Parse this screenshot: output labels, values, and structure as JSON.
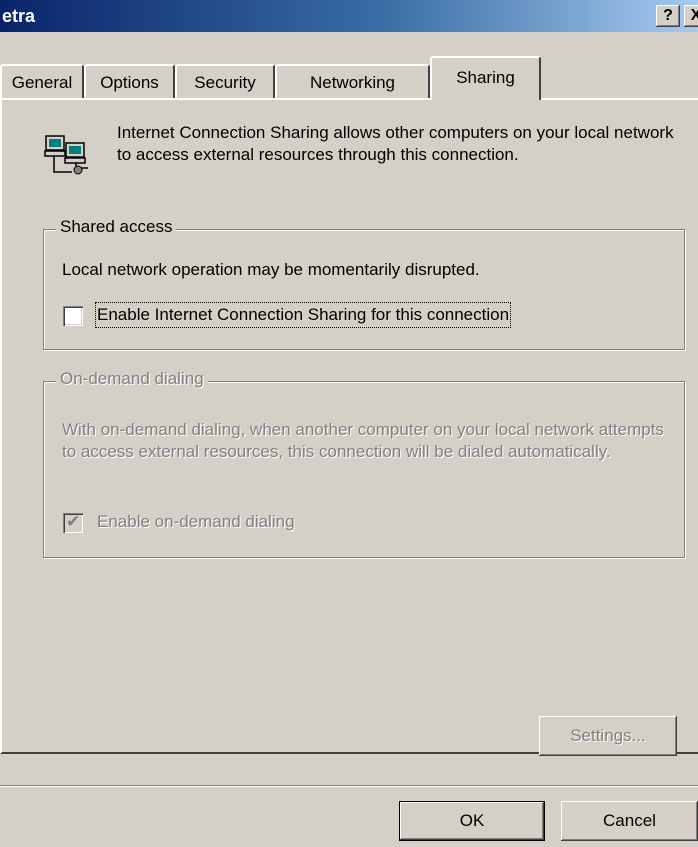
{
  "window": {
    "title": "etra",
    "help_glyph": "?",
    "close_glyph": "X"
  },
  "tabs": [
    {
      "label": "General"
    },
    {
      "label": "Options"
    },
    {
      "label": "Security"
    },
    {
      "label": "Networking"
    },
    {
      "label": "Sharing"
    }
  ],
  "active_tab": "Sharing",
  "info": {
    "icon": "network-computers-icon",
    "text": "Internet Connection Sharing allows other computers on your local network to access external resources through this connection."
  },
  "shared_access": {
    "legend": "Shared access",
    "note": "Local network operation may be momentarily disrupted.",
    "enable_checkbox": {
      "label": "Enable Internet Connection Sharing for this connection",
      "checked": false
    }
  },
  "on_demand": {
    "legend": "On-demand dialing",
    "description": "With on-demand dialing, when another computer on your local network attempts to access external resources, this connection will be dialed automatically.",
    "enable_checkbox": {
      "label": "Enable on-demand dialing",
      "checked": true,
      "enabled": false
    }
  },
  "buttons": {
    "settings": "Settings...",
    "ok": "OK",
    "cancel": "Cancel"
  },
  "colors": {
    "face": "#d4d0c8",
    "title_start": "#0a246a",
    "title_end": "#a6caf0",
    "disabled_text": "#808080"
  }
}
